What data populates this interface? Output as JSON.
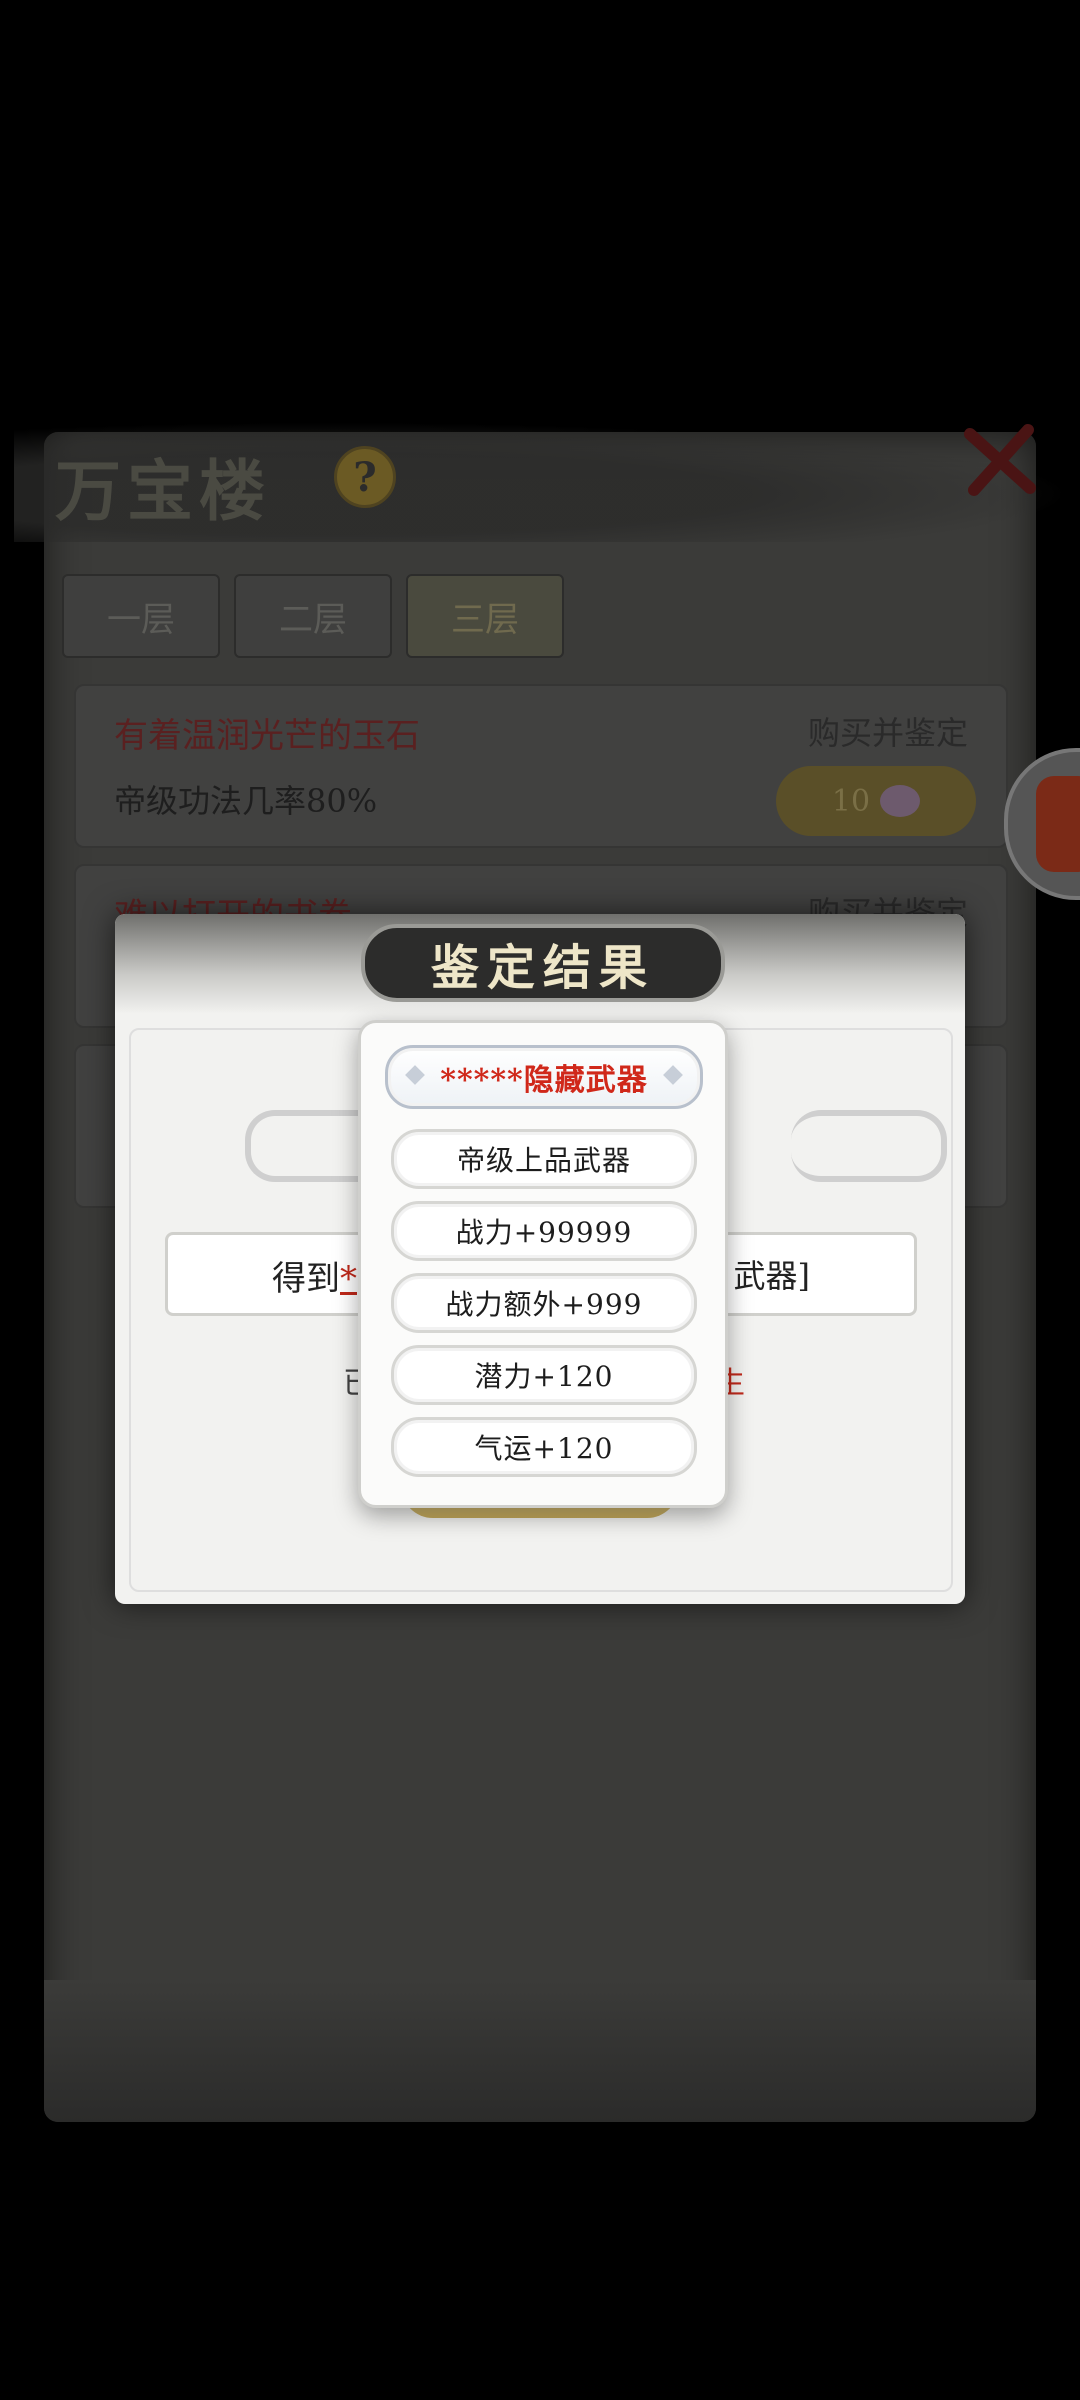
{
  "background": {
    "title": "万宝楼",
    "help_glyph": "?",
    "floor_tabs": [
      {
        "label": "一层"
      },
      {
        "label": "二层"
      },
      {
        "label": "三层"
      }
    ],
    "items": [
      {
        "name": "有着温润光芒的玉石",
        "desc": "帝级功法几率80%",
        "buy_label": "购买并鉴定",
        "price": "10"
      },
      {
        "name": "难以打开的书卷",
        "buy_label": "购买并鉴定"
      }
    ]
  },
  "dialog": {
    "title": "鉴定结果",
    "obtained_prefix": "得到",
    "obtained_marker": "*",
    "obtained_suffix": "武器]",
    "hint_left": "已",
    "hint_right": "生"
  },
  "attributes": {
    "header": "*****隐藏武器",
    "items": [
      "帝级上品武器",
      "战力+99999",
      "战力额外+999",
      "潜力+120",
      "气运+120"
    ]
  }
}
